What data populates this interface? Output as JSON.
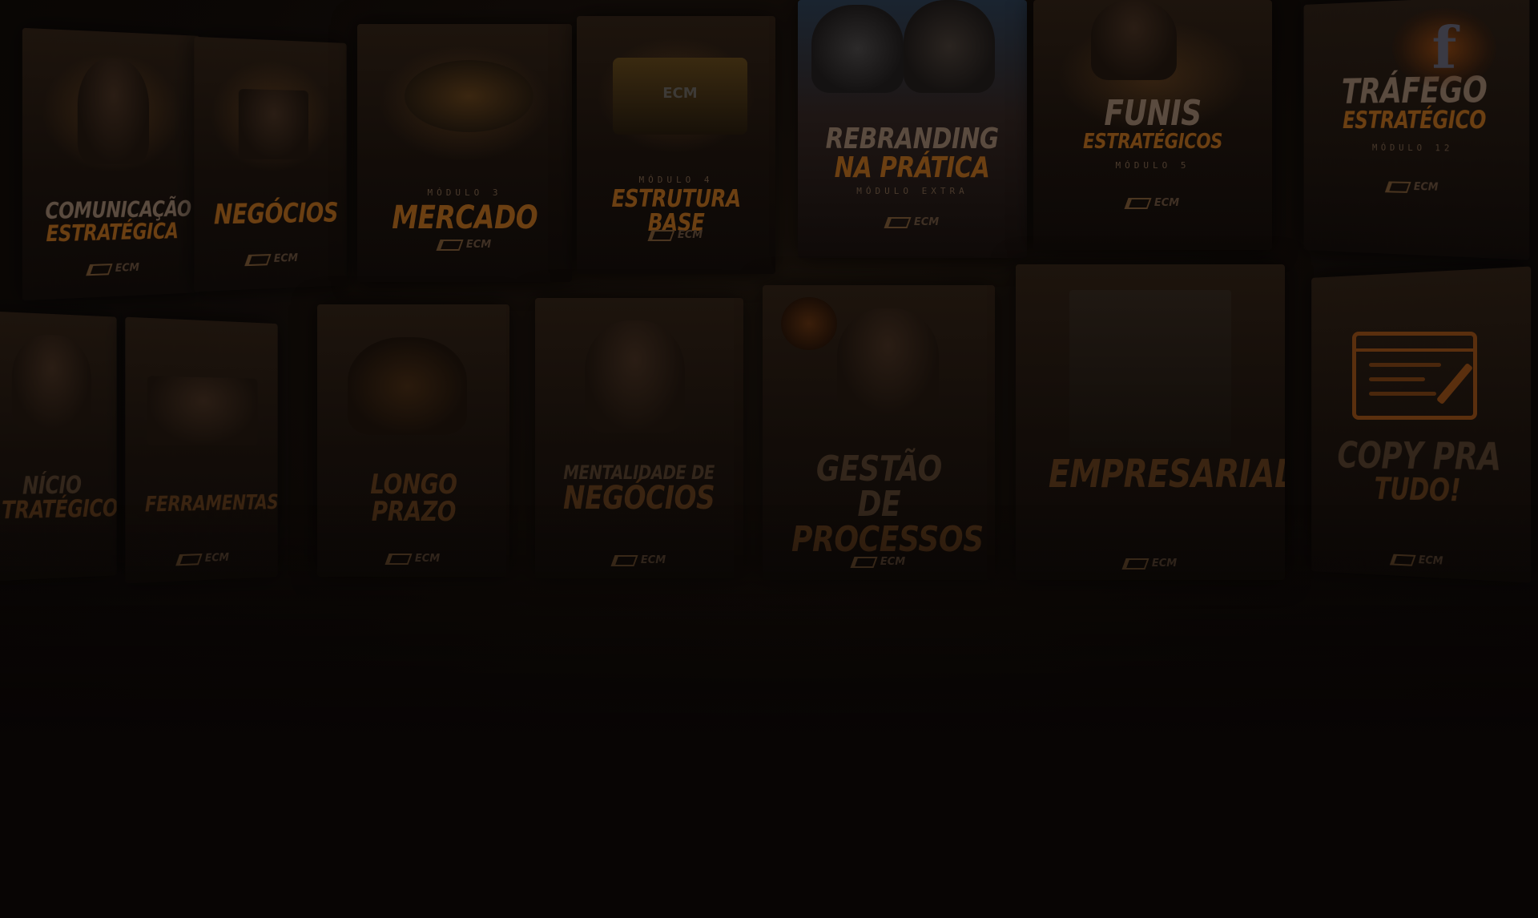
{
  "colors": {
    "background": "#080504",
    "accent_orange": "#6b3f12",
    "title_gray": "#5a4b3f"
  },
  "cards": [
    {
      "id": "comunicacao",
      "title_l1": "COMUNICAÇÃO",
      "title_l2": "ESTRATÉGICA",
      "brand": "ECM"
    },
    {
      "id": "negocios",
      "title_l1": "",
      "title_l2": "NEGÓCIOS",
      "brand": "ECM"
    },
    {
      "id": "mercado",
      "module": "MÓDULO 3",
      "title_l1": "",
      "title_l2": "MERCADO",
      "brand": "ECM"
    },
    {
      "id": "estrutura-base",
      "module": "MÓDULO 4",
      "title_l1": "",
      "title_l2": "ESTRUTURA BASE",
      "brand": "ECM",
      "box_label": "ECM"
    },
    {
      "id": "rebranding",
      "title_l1": "REBRANDING",
      "title_l2": "NA PRÁTICA",
      "module": "MÓDULO EXTRA",
      "brand": "ECM"
    },
    {
      "id": "funis",
      "title_l1": "FUNIS",
      "title_l2": "ESTRATÉGICOS",
      "module": "MÓDULO 5",
      "brand": "ECM"
    },
    {
      "id": "trafego",
      "title_l1": "TRÁFEGO",
      "title_l2": "ESTRATÉGICO",
      "module": "MÓDULO 12",
      "brand": "ECM",
      "icon": "facebook-icon"
    },
    {
      "id": "inicio",
      "title_l1": "NÍCIO",
      "title_l2": "TRATÉGICO",
      "brand": ""
    },
    {
      "id": "ferramentas",
      "title_l1": "",
      "title_l2": "FERRAMENTAS",
      "brand": "ECM"
    },
    {
      "id": "longo-prazo",
      "title_l1": "",
      "title_l2": "LONGO PRAZO",
      "brand": "ECM"
    },
    {
      "id": "mentalidade",
      "title_l1": "MENTALIDADE DE",
      "title_l2": "NEGÓCIOS",
      "brand": "ECM"
    },
    {
      "id": "gestao",
      "title_l1": "GESTÃO DE",
      "title_l2": "PROCESSOS",
      "brand": "ECM"
    },
    {
      "id": "empresarial",
      "title_l1": "",
      "title_l2": "EMPRESARIAL",
      "brand": "ECM"
    },
    {
      "id": "copy",
      "title_l1": "COPY PRA",
      "title_l2": "TUDO!",
      "brand": "ECM",
      "icon": "copy-edit-icon"
    }
  ]
}
